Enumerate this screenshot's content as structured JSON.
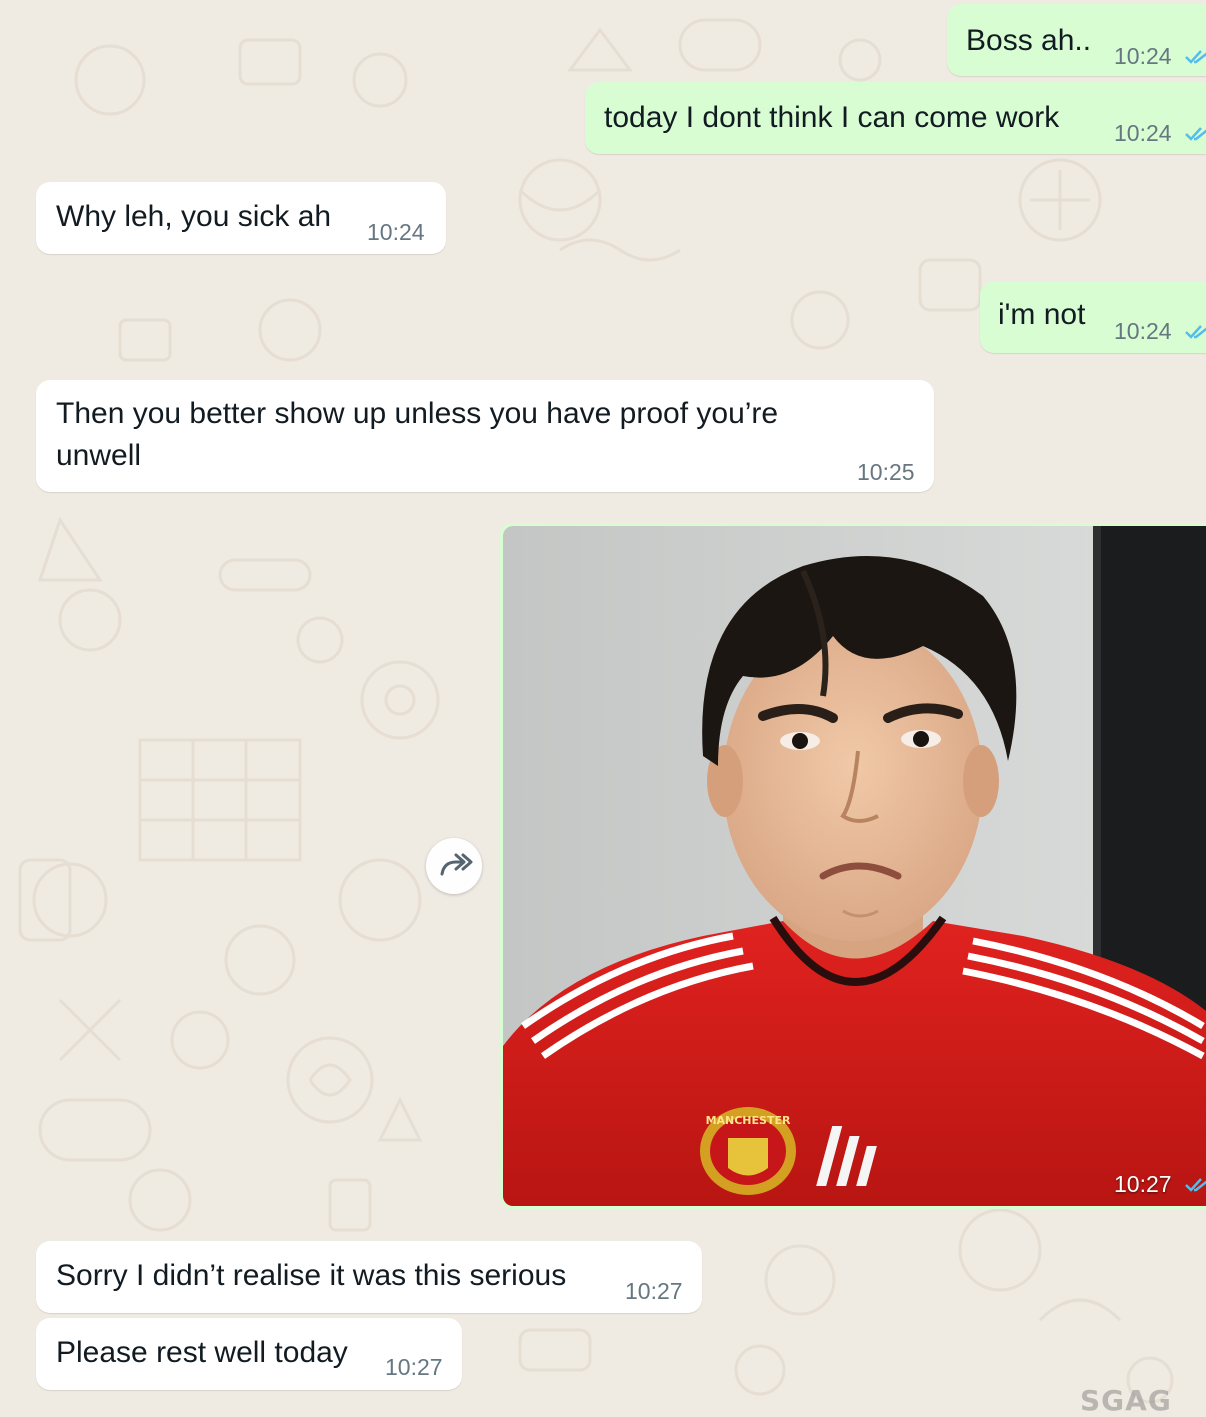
{
  "colors": {
    "background": "#efeae2",
    "incoming_bubble": "#ffffff",
    "outgoing_bubble": "#d9fdd3",
    "read_ticks": "#53bdeb",
    "timestamp": "#667781"
  },
  "messages": [
    {
      "direction": "outgoing",
      "text": "Boss ah..",
      "time": "10:24",
      "status": "read"
    },
    {
      "direction": "outgoing",
      "text": "today I dont think I can come work",
      "time": "10:24",
      "status": "read"
    },
    {
      "direction": "incoming",
      "text": "Why leh, you sick ah",
      "time": "10:24"
    },
    {
      "direction": "outgoing",
      "text": "i'm not",
      "time": "10:24",
      "status": "read"
    },
    {
      "direction": "incoming",
      "text": "Then you better show up unless you have proof you’re unwell",
      "time": "10:25"
    },
    {
      "direction": "outgoing",
      "type": "photo",
      "time": "10:27",
      "status": "read",
      "jersey_text": "MANCHESTER"
    },
    {
      "direction": "incoming",
      "text": "Sorry I didn’t realise it was this serious",
      "time": "10:27"
    },
    {
      "direction": "incoming",
      "text": "Please rest well today",
      "time": "10:27"
    }
  ],
  "forward_icon": "forward-arrow-icon",
  "watermark": "SGAG"
}
